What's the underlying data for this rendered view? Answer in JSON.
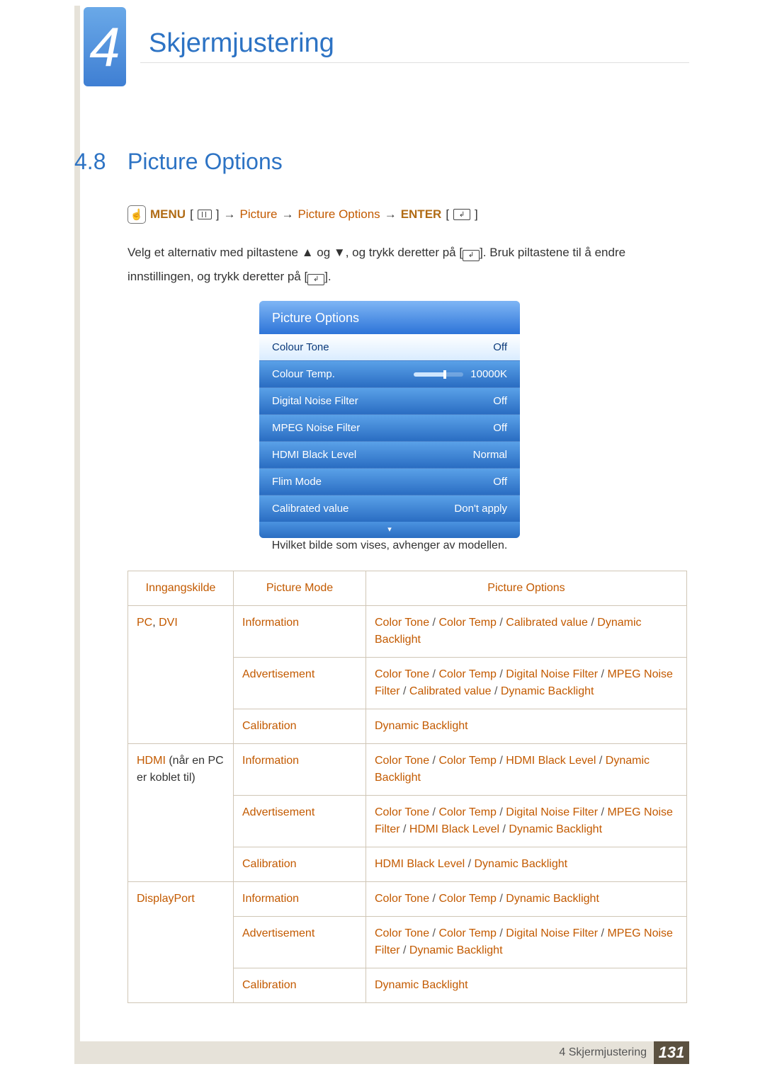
{
  "header": {
    "chapter_number": "4",
    "doc_title": "Skjermjustering"
  },
  "section": {
    "number": "4.8",
    "title": "Picture Options"
  },
  "menu_path": {
    "menu": "MENU",
    "seg1": "Picture",
    "seg2": "Picture Options",
    "enter": "ENTER",
    "arrow": "→",
    "lb": "[",
    "rb": "]"
  },
  "body": {
    "p1a": "Velg et alternativ med piltastene ▲ og ▼, og trykk deretter på [",
    "p1b": "]. Bruk piltastene til å endre innstillingen, og trykk deretter på [",
    "p1c": "]."
  },
  "osd": {
    "title": "Picture Options",
    "rows": [
      {
        "label": "Colour Tone",
        "value": "Off",
        "selected": true
      },
      {
        "label": "Colour Temp.",
        "value": "10000K",
        "slider": true
      },
      {
        "label": "Digital Noise Filter",
        "value": "Off"
      },
      {
        "label": "MPEG Noise Filter",
        "value": "Off"
      },
      {
        "label": "HDMI Black Level",
        "value": "Normal"
      },
      {
        "label": "Flim Mode",
        "value": "Off"
      },
      {
        "label": "Calibrated value",
        "value": "Don't apply"
      }
    ],
    "footer_glyph": "▾"
  },
  "caption": "Hvilket bilde som vises, avhenger av modellen.",
  "table": {
    "headers": [
      "Inngangskilde",
      "Picture Mode",
      "Picture Options"
    ],
    "groups": [
      {
        "source_parts": [
          "PC",
          ", ",
          "DVI"
        ],
        "rows": [
          {
            "mode": "Information",
            "opts": [
              "Color Tone",
              " / ",
              "Color Temp",
              " / ",
              "Calibrated value",
              " / ",
              "Dynamic Backlight"
            ]
          },
          {
            "mode": "Advertisement",
            "opts": [
              "Color Tone",
              " / ",
              "Color Temp",
              " / ",
              "Digital Noise Filter",
              " / ",
              "MPEG Noise Filter",
              " / ",
              "Calibrated value",
              " / ",
              "Dynamic Backlight"
            ]
          },
          {
            "mode": "Calibration",
            "opts": [
              "Dynamic Backlight"
            ]
          }
        ]
      },
      {
        "source_parts": [
          "HDMI",
          " (når en PC er koblet til)"
        ],
        "rows": [
          {
            "mode": "Information",
            "opts": [
              "Color Tone",
              " / ",
              "Color Temp",
              " / ",
              "HDMI Black Level",
              " / ",
              "Dynamic Backlight"
            ]
          },
          {
            "mode": "Advertisement",
            "opts": [
              "Color Tone",
              " / ",
              "Color Temp",
              " / ",
              "Digital Noise Filter",
              " / ",
              "MPEG Noise Filter",
              " / ",
              "HDMI Black Level",
              " / ",
              "Dynamic Backlight"
            ]
          },
          {
            "mode": "Calibration",
            "opts": [
              "HDMI Black Level",
              " / ",
              "Dynamic Backlight"
            ]
          }
        ]
      },
      {
        "source_parts": [
          "DisplayPort"
        ],
        "rows": [
          {
            "mode": "Information",
            "opts": [
              "Color Tone",
              " / ",
              "Color Temp",
              " / ",
              "Dynamic Backlight"
            ]
          },
          {
            "mode": "Advertisement",
            "opts": [
              "Color Tone",
              " / ",
              "Color Temp",
              " / ",
              "Digital Noise Filter",
              " / ",
              "MPEG Noise Filter",
              " / ",
              "Dynamic Backlight"
            ]
          },
          {
            "mode": "Calibration",
            "opts": [
              "Dynamic Backlight"
            ]
          }
        ]
      }
    ]
  },
  "footer": {
    "text": "4 Skjermjustering",
    "page": "131"
  }
}
